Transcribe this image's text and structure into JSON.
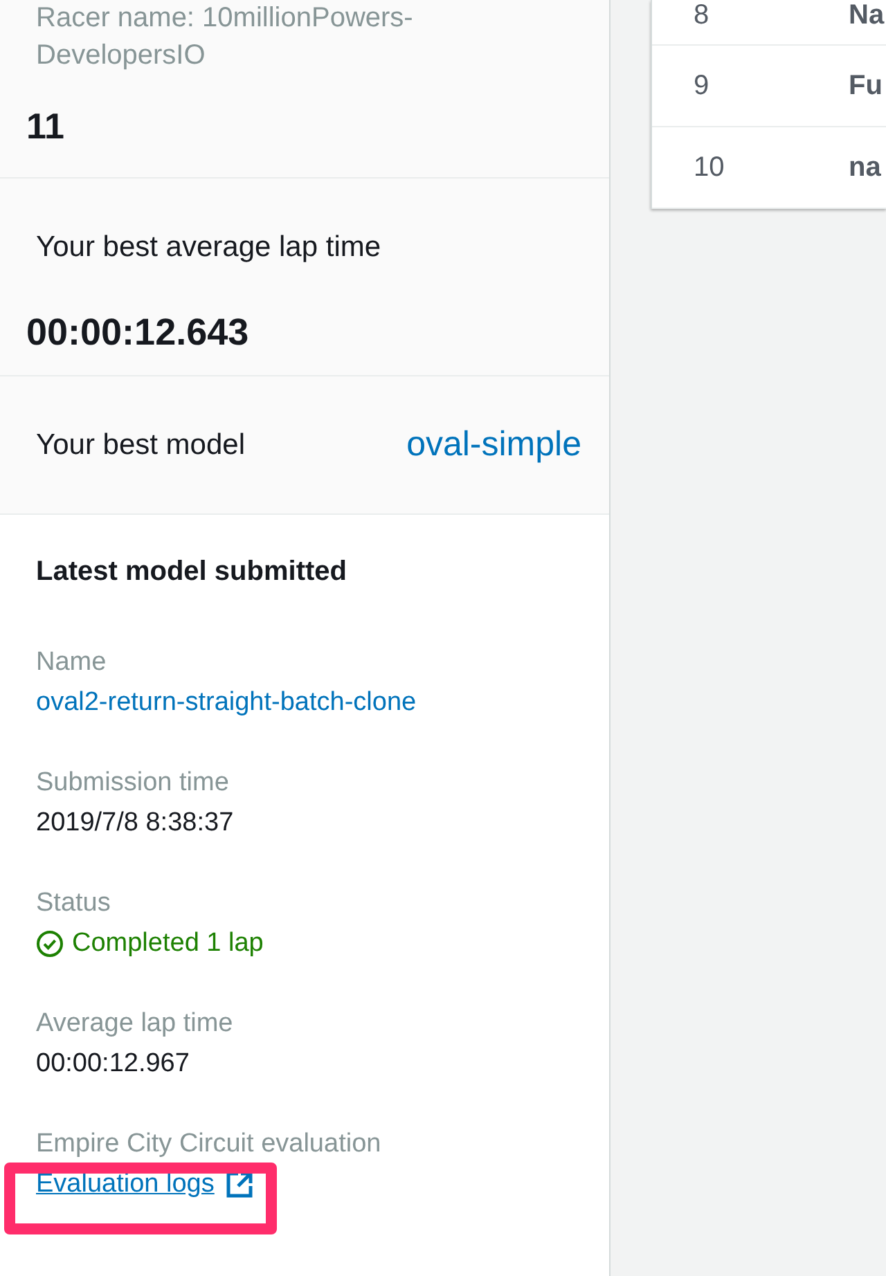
{
  "racer": {
    "name_label": "Racer name: 10millionPowers-DevelopersIO",
    "rank": "11"
  },
  "best_lap": {
    "label": "Your best average lap time",
    "value": "00:00:12.643"
  },
  "best_model": {
    "label": "Your best model",
    "value": "oval-simple"
  },
  "latest": {
    "title": "Latest model submitted",
    "fields": [
      {
        "kind": "link",
        "label": "Name",
        "value": "oval2-return-straight-batch-clone"
      },
      {
        "kind": "text",
        "label": "Submission time",
        "value": "2019/7/8 8:38:37"
      },
      {
        "kind": "status",
        "label": "Status",
        "value": "Completed 1 lap"
      },
      {
        "kind": "text",
        "label": "Average lap time",
        "value": "00:00:12.967"
      },
      {
        "kind": "external",
        "label": "Empire City Circuit evaluation",
        "value": "Evaluation logs"
      }
    ]
  },
  "leaderboard": {
    "rows": [
      {
        "rank": "8",
        "name": "Na"
      },
      {
        "rank": "9",
        "name": "Fu"
      },
      {
        "rank": "10",
        "name": "na"
      }
    ]
  }
}
